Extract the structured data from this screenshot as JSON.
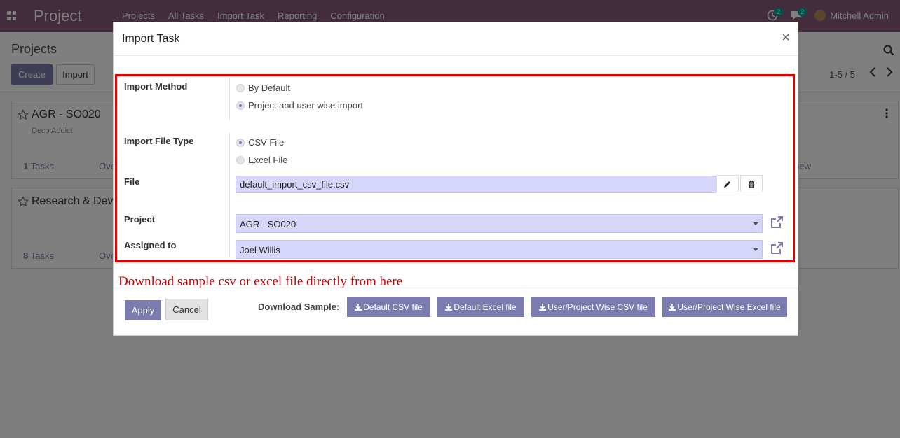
{
  "navbar": {
    "app_title": "Project",
    "menu": [
      "Projects",
      "All Tasks",
      "Import Task",
      "Reporting",
      "Configuration"
    ],
    "activity_count": "2",
    "messages_count": "2",
    "user_name": "Mitchell Admin"
  },
  "control": {
    "breadcrumb": "Projects",
    "create_label": "Create",
    "import_label": "Import",
    "pager": "1-5 / 5"
  },
  "kanban": {
    "cards": [
      {
        "title": "AGR - SO020",
        "subtitle": "Deco Addict",
        "tasks_count": "1",
        "tasks_label": "Tasks",
        "overview": "Ove",
        "view": "iew"
      },
      {
        "title": "Research & Dev",
        "tasks_count": "8",
        "tasks_label": "Tasks",
        "overview": "Ove"
      }
    ]
  },
  "modal": {
    "title": "Import Task",
    "close": "×",
    "import_method": {
      "label": "Import Method",
      "options": [
        "By Default",
        "Project and user wise import"
      ],
      "selected": 1
    },
    "file_type": {
      "label": "Import File Type",
      "options": [
        "CSV File",
        "Excel File"
      ],
      "selected": 0
    },
    "file": {
      "label": "File",
      "value": "default_import_csv_file.csv"
    },
    "project": {
      "label": "Project",
      "value": "AGR - SO020"
    },
    "assigned": {
      "label": "Assigned to",
      "value": "Joel Willis"
    },
    "note": "Download sample csv or excel file directly from here",
    "footer": {
      "apply": "Apply",
      "cancel": "Cancel",
      "download_label": "Download Sample:",
      "downloads": [
        "Default CSV file",
        "Default Excel file",
        "User/Project Wise CSV file",
        "User/Project Wise Excel file"
      ]
    }
  }
}
